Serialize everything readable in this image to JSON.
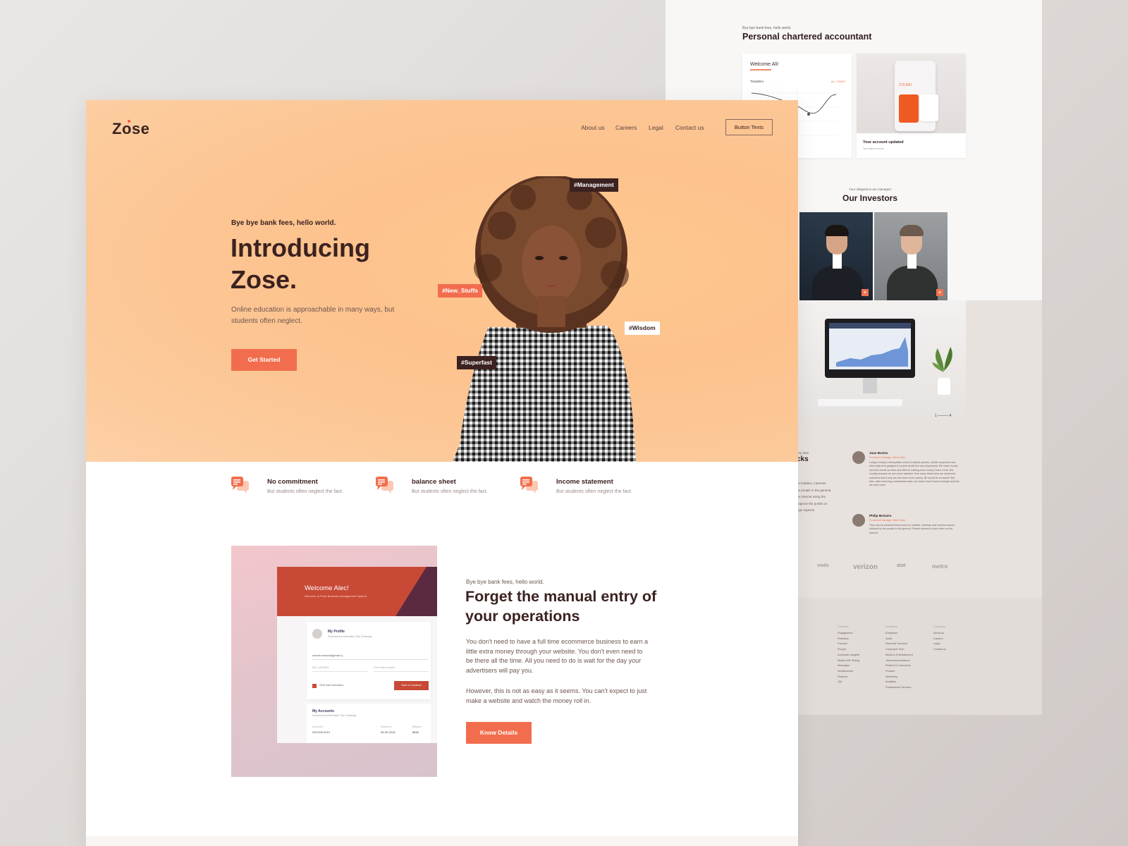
{
  "back_page": {
    "kicker": "Bye bye bank fees, hello world.",
    "title": "Personal chartered accountant",
    "card_a": {
      "welcome": "Welcome Ali!",
      "transfers": "Transfers",
      "all_times": "ALL TIMES"
    },
    "card_b": {
      "amount": "279,800",
      "title": "Your account updated",
      "subtitle": "Your data is secure"
    },
    "investors_kicker": "Your obligations are managed",
    "investors_title": "Our Investors",
    "plus_symbol": "+",
    "slider_pager": "1 ——— 4",
    "left_fragment_kicker": "any time",
    "left_fragment_title": "cks",
    "left_fragment_lines": [
      "as hobbies, interests",
      "he people in the general.",
      "he Internet using the",
      "improve the profile on",
      "sign aspects."
    ],
    "testimonials": [
      {
        "name": "Juan Burton",
        "role": "Production Manager, West Collar",
        "text": "Living in today's metropolitan world of cellular phones, mobile computers and other high-tech gadgets is not just hectic but very impersonal. We make money and then invest our time and effort in making more money. Does it end. Not usually because we are never satisfied. How many times have we convinced ourselves that if only we had some more money, life would be so sweet? But then, after receiving a substantial raise, we realize that it wasn't enough and that we need more."
      },
      {
        "name": "Philip McGuire",
        "role": "Production Manager, West Collar",
        "text": "They can be preferred forms such as hobbies, interests and common issues followed by the people in the general. People connect to each other on the Internet."
      }
    ],
    "logos": [
      "vodo",
      "verizon",
      "atat",
      "metro"
    ],
    "footer": [
      {
        "heading": "Features",
        "items": [
          "Engagement",
          "Retention",
          "Funnels",
          "People",
          "Automatic Insights",
          "Mobile A/B Testing",
          "Messages",
          "Infrastructure",
          "Platform",
          "JQL"
        ]
      },
      {
        "heading": "Solutions",
        "items": [
          "Enterprise",
          "SaaS",
          "Financial Services",
          "Consumer Tech",
          "Media & Entertainment",
          "Telecommunications",
          "Retail & E-commerce",
          "Product",
          "Marketing",
          "Analytics",
          "Professional Services"
        ]
      },
      {
        "heading": "Company",
        "items": [
          "About us",
          "Careers",
          "Legal",
          "Contact us"
        ]
      }
    ]
  },
  "header": {
    "logo": "Zose",
    "nav": [
      "About us",
      "Careers",
      "Legal",
      "Contact us"
    ],
    "cta": "Button Texts"
  },
  "hero": {
    "kicker": "Bye bye bank fees, hello world.",
    "title": "Introducing Zose.",
    "lead": "Online education is approachable in many ways, but students often neglect.",
    "button": "Get Started",
    "tags": [
      "#Management",
      "#New_Stuffs",
      "#Wisdom",
      "#Superfast"
    ]
  },
  "features": [
    {
      "title": "No commitment",
      "subtitle": "But students often neglect the fact."
    },
    {
      "title": "balance sheet",
      "subtitle": "But students often neglect the fact."
    },
    {
      "title": "Income statement",
      "subtitle": "But students often neglect the fact."
    }
  ],
  "mockup": {
    "welcome": "Welcome Alec!",
    "welcome_sub": "Welcome to Porto Business Management System.",
    "profile_title": "My Profile",
    "profile_sub": "Kindness And Motivation Tips Challenge.",
    "email": "cramin.mason@gmail.c|",
    "phone_placeholder": "861-126-9599",
    "address_placeholder": "Post Addr/number",
    "sms_label": "SMS Alert Activation",
    "save_button": "Save & Continue",
    "accounts_title": "My Accounts",
    "accounts_sub": "Kindness And Motivation Tips Challenge.",
    "col_headers": [
      "Account #",
      "Expires in",
      "Balance"
    ],
    "col_values": [
      "293-328-0913",
      "06-30-2018",
      "$656"
    ]
  },
  "content": {
    "kicker": "Bye bye bank fees, hello world.",
    "title": "Forget the manual entry of your operations",
    "body1": "You don't need to have a full time ecommerce business to earn a little extra money through your website. You don't even need to be there all the time. All you need to do is wait for the day your advertisers will pay you.",
    "body2": "However, this is not as easy as it seems. You can't expect to just make a website and watch the money roll in.",
    "button": "Know Details"
  },
  "colors": {
    "accent": "#f26d4d",
    "dark": "#3b2220",
    "hero_bg": "#fdc28d"
  }
}
